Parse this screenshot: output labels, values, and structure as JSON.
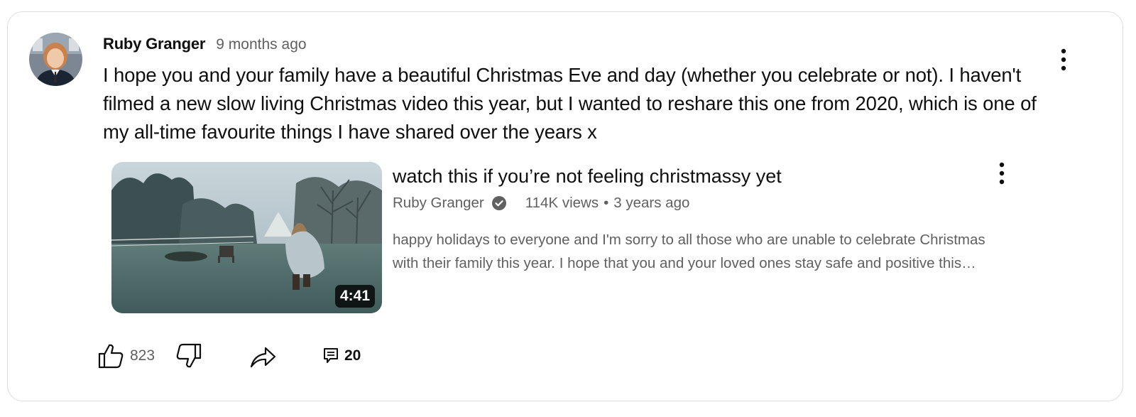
{
  "comment": {
    "author": "Ruby Granger",
    "time": "9 months ago",
    "text": "I hope you and your family have a beautiful Christmas Eve and day (whether you celebrate or not). I haven't filmed a new slow living Christmas video this year, but I wanted to reshare this one from 2020, which is one of my all-time favourite things I have shared over the years x",
    "avatar_icon": "avatar-photo",
    "more_icon": "more-vertical-icon"
  },
  "video": {
    "title": "watch this if you’re not feeling christmassy yet",
    "channel": "Ruby Granger",
    "verified_icon": "verified-check-icon",
    "views": "114K views",
    "separator": "•",
    "age": "3 years ago",
    "duration": "4:41",
    "description_lines": [
      "happy holidays to everyone and I'm sorry to all those who are unable to celebrate Christmas",
      "with their family this year. I hope that you and your loved ones stay safe and positive this…"
    ],
    "more_icon": "more-vertical-icon"
  },
  "actions": {
    "like_count": "823",
    "reply_count": "20",
    "icons": [
      "thumbs-up-icon",
      "thumbs-down-icon",
      "share-icon",
      "reply-icon"
    ]
  },
  "colors": {
    "primary_text": "#0f0f0f",
    "secondary_text": "#606060",
    "border": "#dcdcdc"
  }
}
